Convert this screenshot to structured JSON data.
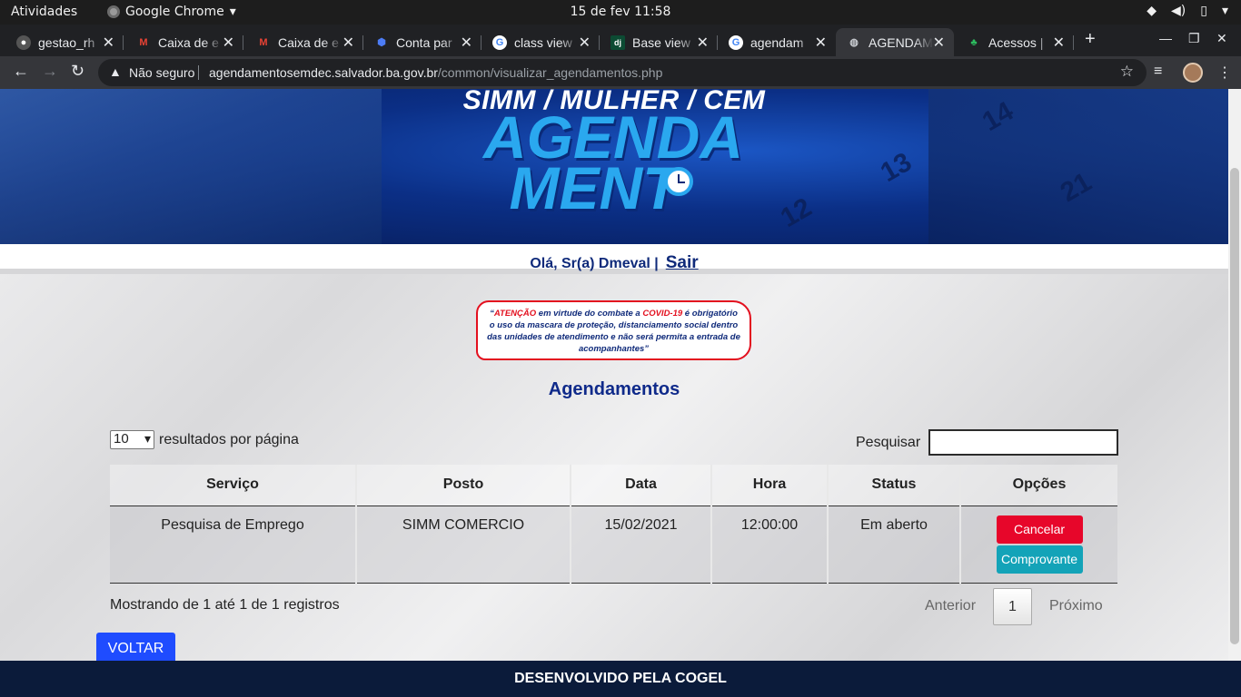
{
  "os": {
    "activities": "Atividades",
    "app_name": "Google Chrome",
    "clock": "15 de fev  11:58"
  },
  "browser": {
    "tabs": [
      {
        "title": "gestao_rh",
        "favicon": "github-icon"
      },
      {
        "title": "Caixa de e",
        "favicon": "gmail-icon"
      },
      {
        "title": "Caixa de e",
        "favicon": "gmail-icon"
      },
      {
        "title": "Conta par",
        "favicon": "hexagon-icon"
      },
      {
        "title": "class view",
        "favicon": "google-icon"
      },
      {
        "title": "Base view",
        "favicon": "django-icon"
      },
      {
        "title": "agendam",
        "favicon": "google-icon"
      },
      {
        "title": "AGENDAM",
        "favicon": "globe-icon"
      },
      {
        "title": "Acessos |",
        "favicon": "evernote-icon"
      }
    ],
    "security_label": "Não seguro",
    "url_host": "agendamentosemdec.salvador.ba.gov.br",
    "url_path": "/common/visualizar_agendamentos.php"
  },
  "banner": {
    "heading": "SIMM / MULHER / CEM",
    "big_line1": "AGENDA",
    "big_line2": "MENT",
    "cal_numbers": [
      "14",
      "13",
      "21",
      "12"
    ]
  },
  "header": {
    "greeting": "Olá, Sr(a) Dmeval  |",
    "logout_label": "Sair"
  },
  "notice": {
    "open_quote": "“",
    "attention": "ATENÇÃO",
    "text1": " em virtude do combate a ",
    "covid": "COVID-19",
    "text2": " é obrigatório o uso da mascara de proteção, distanciamento social dentro das unidades de atendimento e não será permita a entrada de acompanhantes”"
  },
  "main": {
    "title": "Agendamentos",
    "page_length_value": "10",
    "page_length_label": "resultados por página",
    "search_label": "Pesquisar",
    "search_value": "",
    "columns": [
      "Serviço",
      "Posto",
      "Data",
      "Hora",
      "Status",
      "Opções"
    ],
    "rows": [
      {
        "servico": "Pesquisa de Emprego",
        "posto": "SIMM COMERCIO",
        "data": "15/02/2021",
        "hora": "12:00:00",
        "status": "Em aberto",
        "cancel_label": "Cancelar",
        "receipt_label": "Comprovante"
      }
    ],
    "info": "Mostrando de 1 até 1 de 1 registros",
    "prev_label": "Anterior",
    "current_page": "1",
    "next_label": "Próximo",
    "back_label": "VOLTAR"
  },
  "footer": {
    "text": "DESENVOLVIDO PELA COGEL"
  },
  "colors": {
    "brand_blue": "#0f2a7a",
    "cancel": "#e7062a",
    "receipt": "#13a3b8",
    "back": "#1f4cff",
    "footer": "#0b1b3a"
  }
}
